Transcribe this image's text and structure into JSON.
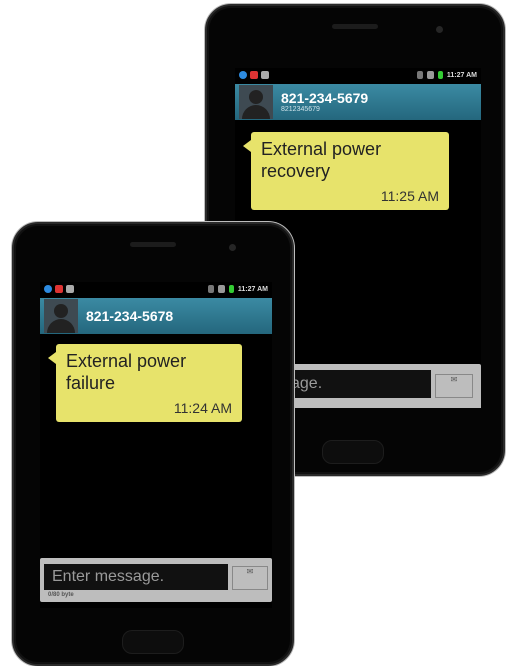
{
  "back_phone": {
    "status": {
      "time": "11:27 AM"
    },
    "header": {
      "contact": "821-234-5679",
      "sub": "8212345679"
    },
    "message": {
      "text": "External power recovery",
      "time": "11:25 AM"
    },
    "composer": {
      "placeholder_visible": "r message."
    }
  },
  "front_phone": {
    "status": {
      "time": "11:27 AM"
    },
    "header": {
      "contact": "821-234-5678"
    },
    "message": {
      "text": "External power failure",
      "time": "11:24 AM"
    },
    "composer": {
      "placeholder": "Enter message.",
      "counter": "0/80 byte"
    }
  },
  "colors": {
    "header": "#2f7b92",
    "bubble": "#e7e36b",
    "phone_body": "#050505"
  }
}
